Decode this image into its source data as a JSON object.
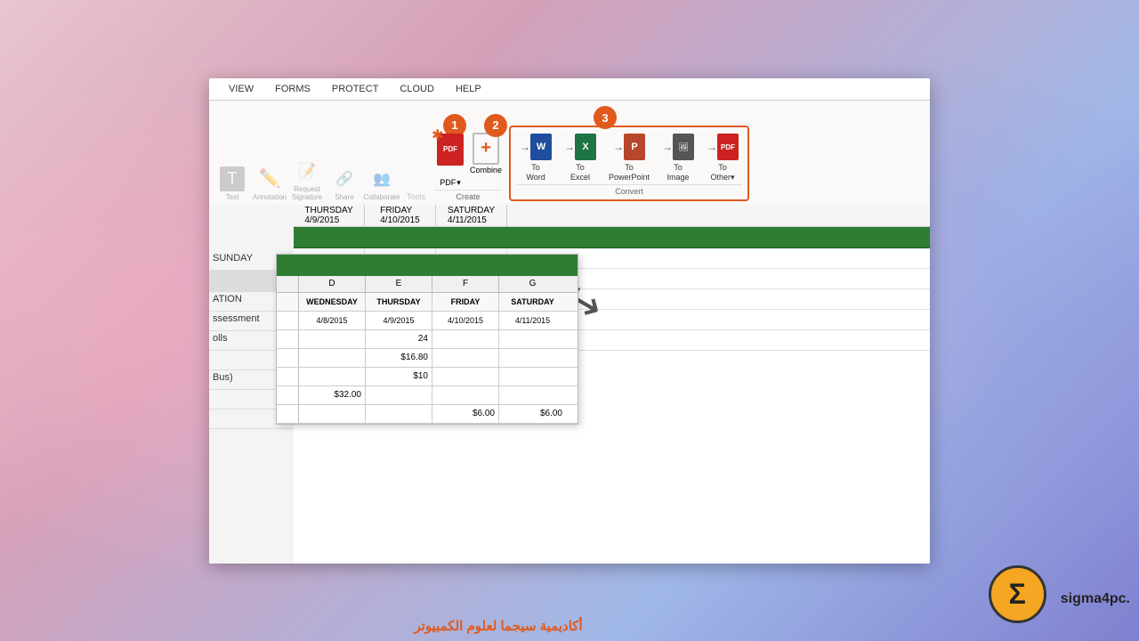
{
  "background": {
    "color_left": "#d4a0b8",
    "color_right": "#8080d0"
  },
  "ribbon": {
    "tabs": [
      "VIEW",
      "FORMS",
      "PROTECT",
      "CLOUD",
      "HELP"
    ],
    "groups": {
      "create": {
        "label": "Create",
        "pdf_label": "PDF",
        "combine_label": "Combine"
      },
      "convert": {
        "label": "Convert",
        "buttons": [
          {
            "label": "To\nWord",
            "app": "W"
          },
          {
            "label": "To\nExcel",
            "app": "X"
          },
          {
            "label": "To\nPowerPoint",
            "app": "P"
          },
          {
            "label": "To\nImage",
            "app": "img"
          },
          {
            "label": "To\nOther•",
            "app": "pdf"
          }
        ]
      }
    }
  },
  "steps": {
    "badge1": "1",
    "badge2": "2",
    "badge3": "3"
  },
  "spreadsheet": {
    "columns": [
      "",
      "D",
      "E",
      "F",
      "G"
    ],
    "days": [
      "WEDNESDAY",
      "THURSDAY",
      "FRIDAY",
      "SATURDAY"
    ],
    "dates": [
      "4/8/2015",
      "4/9/2015",
      "4/10/2015",
      "4/11/2015"
    ],
    "rows": [
      {
        "label": "",
        "values": [
          "",
          "24",
          "",
          ""
        ]
      },
      {
        "label": "",
        "values": [
          "",
          "$16.80",
          "",
          ""
        ]
      },
      {
        "label": "",
        "values": [
          "",
          "$10",
          "",
          ""
        ]
      },
      {
        "label": "",
        "values": [
          "$32.00",
          "",
          "",
          ""
        ]
      },
      {
        "label": "",
        "values": [
          "",
          "",
          "$6.00",
          "$6.00"
        ]
      }
    ]
  },
  "main_spreadsheet": {
    "days": [
      "THURSDAY",
      "FRIDAY",
      "SATURDAY"
    ],
    "header_dates": [
      "4/9/2015",
      "4/10/2015",
      "4/11/2015"
    ],
    "values": [
      "24",
      "$16.80",
      "$10.00",
      "$32.00",
      "$6.00",
      "$6.00"
    ]
  },
  "sigma": {
    "name": "sigma4pc.",
    "tagline": "أكاديمية سيجما لعلوم الكمبيوتر",
    "icon": "Σ"
  },
  "labels": {
    "ation": "ATION",
    "assessment": "ssessment",
    "rolls": "olls",
    "bus": "Bus)"
  }
}
